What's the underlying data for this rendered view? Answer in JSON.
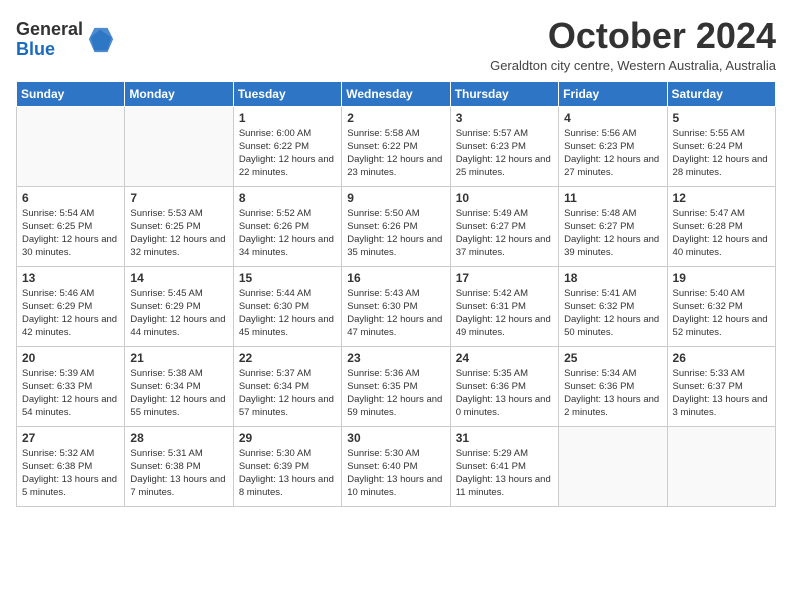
{
  "header": {
    "logo_line1": "General",
    "logo_line2": "Blue",
    "month_title": "October 2024",
    "subtitle": "Geraldton city centre, Western Australia, Australia"
  },
  "calendar": {
    "weekdays": [
      "Sunday",
      "Monday",
      "Tuesday",
      "Wednesday",
      "Thursday",
      "Friday",
      "Saturday"
    ],
    "weeks": [
      [
        {
          "day": "",
          "info": ""
        },
        {
          "day": "",
          "info": ""
        },
        {
          "day": "1",
          "info": "Sunrise: 6:00 AM\nSunset: 6:22 PM\nDaylight: 12 hours and 22 minutes."
        },
        {
          "day": "2",
          "info": "Sunrise: 5:58 AM\nSunset: 6:22 PM\nDaylight: 12 hours and 23 minutes."
        },
        {
          "day": "3",
          "info": "Sunrise: 5:57 AM\nSunset: 6:23 PM\nDaylight: 12 hours and 25 minutes."
        },
        {
          "day": "4",
          "info": "Sunrise: 5:56 AM\nSunset: 6:23 PM\nDaylight: 12 hours and 27 minutes."
        },
        {
          "day": "5",
          "info": "Sunrise: 5:55 AM\nSunset: 6:24 PM\nDaylight: 12 hours and 28 minutes."
        }
      ],
      [
        {
          "day": "6",
          "info": "Sunrise: 5:54 AM\nSunset: 6:25 PM\nDaylight: 12 hours and 30 minutes."
        },
        {
          "day": "7",
          "info": "Sunrise: 5:53 AM\nSunset: 6:25 PM\nDaylight: 12 hours and 32 minutes."
        },
        {
          "day": "8",
          "info": "Sunrise: 5:52 AM\nSunset: 6:26 PM\nDaylight: 12 hours and 34 minutes."
        },
        {
          "day": "9",
          "info": "Sunrise: 5:50 AM\nSunset: 6:26 PM\nDaylight: 12 hours and 35 minutes."
        },
        {
          "day": "10",
          "info": "Sunrise: 5:49 AM\nSunset: 6:27 PM\nDaylight: 12 hours and 37 minutes."
        },
        {
          "day": "11",
          "info": "Sunrise: 5:48 AM\nSunset: 6:27 PM\nDaylight: 12 hours and 39 minutes."
        },
        {
          "day": "12",
          "info": "Sunrise: 5:47 AM\nSunset: 6:28 PM\nDaylight: 12 hours and 40 minutes."
        }
      ],
      [
        {
          "day": "13",
          "info": "Sunrise: 5:46 AM\nSunset: 6:29 PM\nDaylight: 12 hours and 42 minutes."
        },
        {
          "day": "14",
          "info": "Sunrise: 5:45 AM\nSunset: 6:29 PM\nDaylight: 12 hours and 44 minutes."
        },
        {
          "day": "15",
          "info": "Sunrise: 5:44 AM\nSunset: 6:30 PM\nDaylight: 12 hours and 45 minutes."
        },
        {
          "day": "16",
          "info": "Sunrise: 5:43 AM\nSunset: 6:30 PM\nDaylight: 12 hours and 47 minutes."
        },
        {
          "day": "17",
          "info": "Sunrise: 5:42 AM\nSunset: 6:31 PM\nDaylight: 12 hours and 49 minutes."
        },
        {
          "day": "18",
          "info": "Sunrise: 5:41 AM\nSunset: 6:32 PM\nDaylight: 12 hours and 50 minutes."
        },
        {
          "day": "19",
          "info": "Sunrise: 5:40 AM\nSunset: 6:32 PM\nDaylight: 12 hours and 52 minutes."
        }
      ],
      [
        {
          "day": "20",
          "info": "Sunrise: 5:39 AM\nSunset: 6:33 PM\nDaylight: 12 hours and 54 minutes."
        },
        {
          "day": "21",
          "info": "Sunrise: 5:38 AM\nSunset: 6:34 PM\nDaylight: 12 hours and 55 minutes."
        },
        {
          "day": "22",
          "info": "Sunrise: 5:37 AM\nSunset: 6:34 PM\nDaylight: 12 hours and 57 minutes."
        },
        {
          "day": "23",
          "info": "Sunrise: 5:36 AM\nSunset: 6:35 PM\nDaylight: 12 hours and 59 minutes."
        },
        {
          "day": "24",
          "info": "Sunrise: 5:35 AM\nSunset: 6:36 PM\nDaylight: 13 hours and 0 minutes."
        },
        {
          "day": "25",
          "info": "Sunrise: 5:34 AM\nSunset: 6:36 PM\nDaylight: 13 hours and 2 minutes."
        },
        {
          "day": "26",
          "info": "Sunrise: 5:33 AM\nSunset: 6:37 PM\nDaylight: 13 hours and 3 minutes."
        }
      ],
      [
        {
          "day": "27",
          "info": "Sunrise: 5:32 AM\nSunset: 6:38 PM\nDaylight: 13 hours and 5 minutes."
        },
        {
          "day": "28",
          "info": "Sunrise: 5:31 AM\nSunset: 6:38 PM\nDaylight: 13 hours and 7 minutes."
        },
        {
          "day": "29",
          "info": "Sunrise: 5:30 AM\nSunset: 6:39 PM\nDaylight: 13 hours and 8 minutes."
        },
        {
          "day": "30",
          "info": "Sunrise: 5:30 AM\nSunset: 6:40 PM\nDaylight: 13 hours and 10 minutes."
        },
        {
          "day": "31",
          "info": "Sunrise: 5:29 AM\nSunset: 6:41 PM\nDaylight: 13 hours and 11 minutes."
        },
        {
          "day": "",
          "info": ""
        },
        {
          "day": "",
          "info": ""
        }
      ]
    ]
  }
}
